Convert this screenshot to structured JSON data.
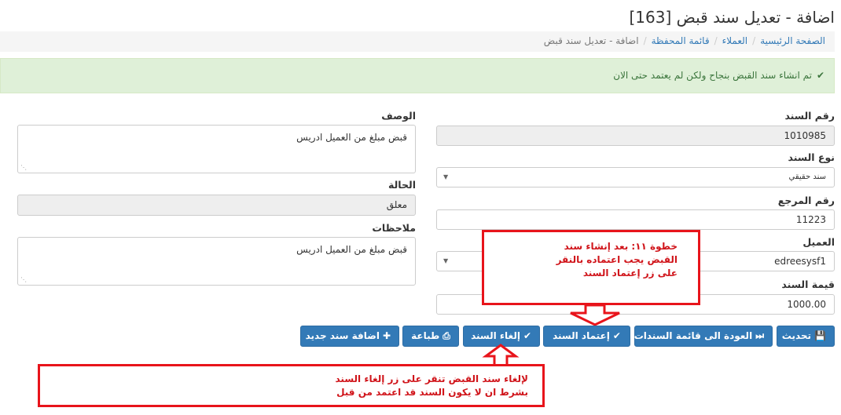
{
  "page": {
    "title": "اضافة - تعديل سند قبض [163]"
  },
  "breadcrumb": {
    "items": [
      "الصفحة الرئيسية",
      "العملاء",
      "قائمة المحفظة"
    ],
    "active": "اضافة - تعديل سند قبض"
  },
  "alert": {
    "message": "تم انشاء سند القبض بنجاح ولكن لم يعتمد حتى الان"
  },
  "form": {
    "voucher_number_label": "رقم السند",
    "voucher_number_value": "1010985",
    "voucher_type_label": "نوع السند",
    "voucher_type_value": "سند حقيقي",
    "reference_number_label": "رقم المرجع",
    "reference_number_value": "11223",
    "customer_label": "العميل",
    "customer_value": "edreesysf1",
    "voucher_amount_label": "قيمة السند",
    "voucher_amount_value": "1000.00",
    "description_label": "الوصف",
    "description_value": "قبض مبلغ من العميل ادريس",
    "status_label": "الحالة",
    "status_value": "معلق",
    "notes_label": "ملاحظات",
    "notes_value": "قبض مبلغ من العميل ادريس"
  },
  "buttons": {
    "update": "تحديث",
    "back_to_list": "العودة الى قائمة السندات",
    "approve": "إعتماد السند",
    "cancel": "إلغاء السند",
    "print": "طباعة",
    "add_new": "اضافة سند جديد"
  },
  "annotations": {
    "step11_lines": [
      "خطوة ١١: بعد إنشاء سند",
      "القبض يجب اعتماده بالنقر",
      "على زر إعتماد السند"
    ],
    "cancel_lines": [
      "لإلغاء سند القبض تنقر على زر إلغاء السند",
      "بشرط ان لا يكون السند قد اعتمد من قبل"
    ]
  },
  "colors": {
    "primary": "#337ab7",
    "success_bg": "#dff0d8",
    "success_text": "#3c763d",
    "annotation_red": "#e8141b"
  }
}
